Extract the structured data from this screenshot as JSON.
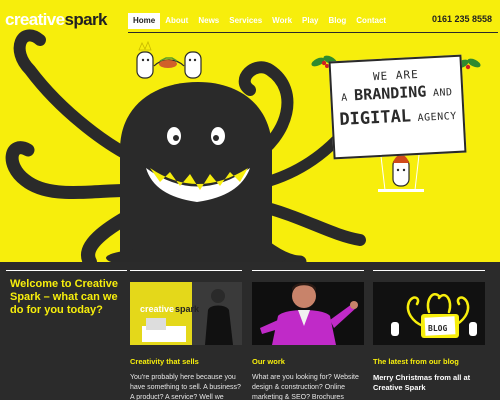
{
  "brand": {
    "logo_light": "creative",
    "logo_dark": "spark"
  },
  "nav": {
    "items": [
      {
        "label": "Home",
        "active": true
      },
      {
        "label": "About"
      },
      {
        "label": "News"
      },
      {
        "label": "Services"
      },
      {
        "label": "Work"
      },
      {
        "label": "Play"
      },
      {
        "label": "Blog"
      },
      {
        "label": "Contact"
      }
    ]
  },
  "header": {
    "phone": "0161 235 8558"
  },
  "hero": {
    "sign_line1": "WE ARE",
    "sign_line2_a": "A ",
    "sign_line2_b": "BRANDING",
    "sign_line2_c": " AND",
    "sign_line3_a": "DIGITAL",
    "sign_line3_b": " AGENCY"
  },
  "welcome": {
    "heading": "Welcome to Creative Spark – what can we do for you today?"
  },
  "columns": [
    {
      "title": "Creativity that sells",
      "text": "You're probably here because you have something to sell. A business? A product? A service? Well we create marketing that"
    },
    {
      "title": "Our work",
      "text": "What are you looking for? Website design & construction? Online marketing & SEO? Brochures design & print? Flyers? Posters"
    },
    {
      "title": "The latest from our blog",
      "text": "Merry Christmas from all at Creative Spark",
      "blog_label": "BLOG"
    }
  ],
  "colors": {
    "brand_yellow": "#f7ee0c",
    "dark": "#2b2b2b",
    "white": "#ffffff"
  }
}
